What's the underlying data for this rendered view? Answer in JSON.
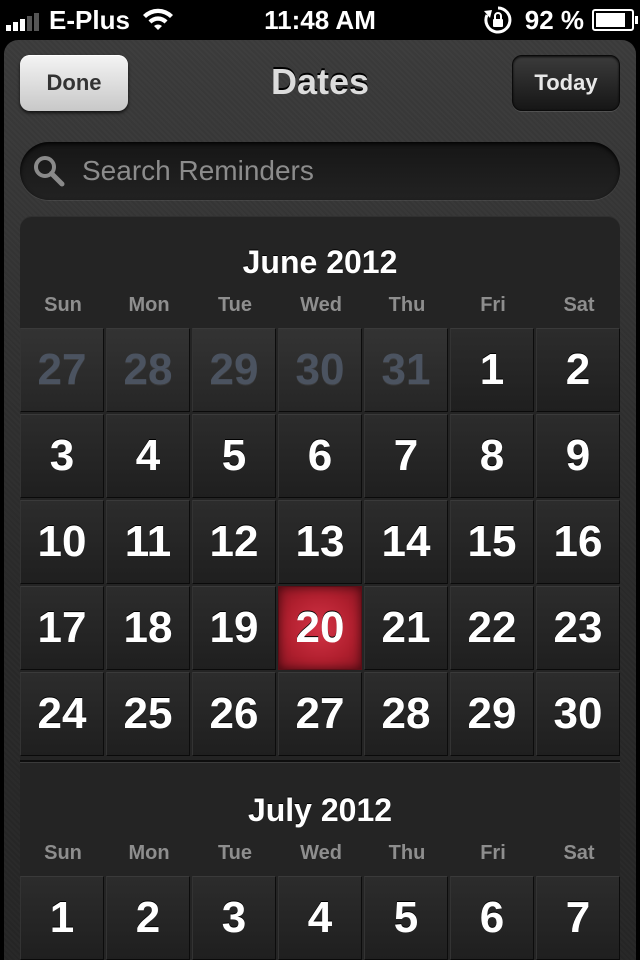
{
  "status_bar": {
    "carrier": "E-Plus",
    "time": "11:48 AM",
    "battery_percent": "92 %",
    "battery_level": 0.92,
    "signal_bars_filled": 3,
    "signal_bars_total": 5,
    "icons": [
      "signal-icon",
      "wifi-icon",
      "rotation-lock-icon",
      "battery-icon"
    ]
  },
  "nav": {
    "done_label": "Done",
    "title": "Dates",
    "today_label": "Today"
  },
  "search": {
    "placeholder": "Search Reminders",
    "value": ""
  },
  "weekdays": [
    "Sun",
    "Mon",
    "Tue",
    "Wed",
    "Thu",
    "Fri",
    "Sat"
  ],
  "months": [
    {
      "title": "June 2012",
      "weeks": [
        [
          {
            "day": "27",
            "outside": true
          },
          {
            "day": "28",
            "outside": true
          },
          {
            "day": "29",
            "outside": true
          },
          {
            "day": "30",
            "outside": true
          },
          {
            "day": "31",
            "outside": true
          },
          {
            "day": "1"
          },
          {
            "day": "2"
          }
        ],
        [
          {
            "day": "3"
          },
          {
            "day": "4"
          },
          {
            "day": "5"
          },
          {
            "day": "6"
          },
          {
            "day": "7"
          },
          {
            "day": "8"
          },
          {
            "day": "9"
          }
        ],
        [
          {
            "day": "10"
          },
          {
            "day": "11"
          },
          {
            "day": "12"
          },
          {
            "day": "13"
          },
          {
            "day": "14"
          },
          {
            "day": "15"
          },
          {
            "day": "16"
          }
        ],
        [
          {
            "day": "17"
          },
          {
            "day": "18"
          },
          {
            "day": "19"
          },
          {
            "day": "20",
            "today": true
          },
          {
            "day": "21"
          },
          {
            "day": "22"
          },
          {
            "day": "23"
          }
        ],
        [
          {
            "day": "24"
          },
          {
            "day": "25"
          },
          {
            "day": "26"
          },
          {
            "day": "27"
          },
          {
            "day": "28"
          },
          {
            "day": "29"
          },
          {
            "day": "30"
          }
        ]
      ]
    },
    {
      "title": "July 2012",
      "weeks": [
        [
          {
            "day": "1"
          },
          {
            "day": "2"
          },
          {
            "day": "3"
          },
          {
            "day": "4"
          },
          {
            "day": "5"
          },
          {
            "day": "6"
          },
          {
            "day": "7"
          }
        ]
      ]
    }
  ],
  "colors": {
    "today_highlight": "#c2273a",
    "outside_day_text": "#4b5360",
    "weekday_text": "#8e8e8e"
  }
}
